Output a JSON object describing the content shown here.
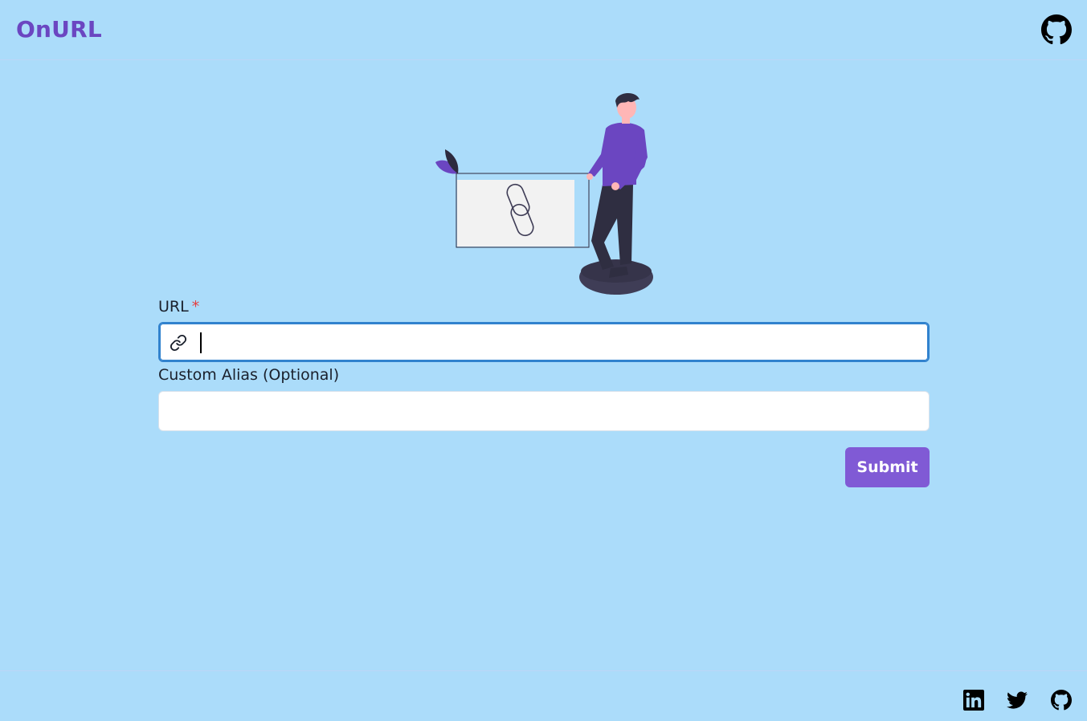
{
  "header": {
    "brand": "OnURL",
    "github_icon": "github-icon"
  },
  "form": {
    "url_label": "URL",
    "url_required_mark": "*",
    "url_value": "",
    "url_icon": "link-icon",
    "alias_label": "Custom Alias (Optional)",
    "alias_value": "",
    "submit_label": "Submit"
  },
  "footer": {
    "icons": [
      "linkedin-icon",
      "twitter-icon",
      "github-icon"
    ]
  },
  "colors": {
    "background": "#abdcfa",
    "brand": "#6b46c1",
    "button": "#805ad5",
    "focus_border": "#3182ce",
    "required": "#e53e3e"
  }
}
